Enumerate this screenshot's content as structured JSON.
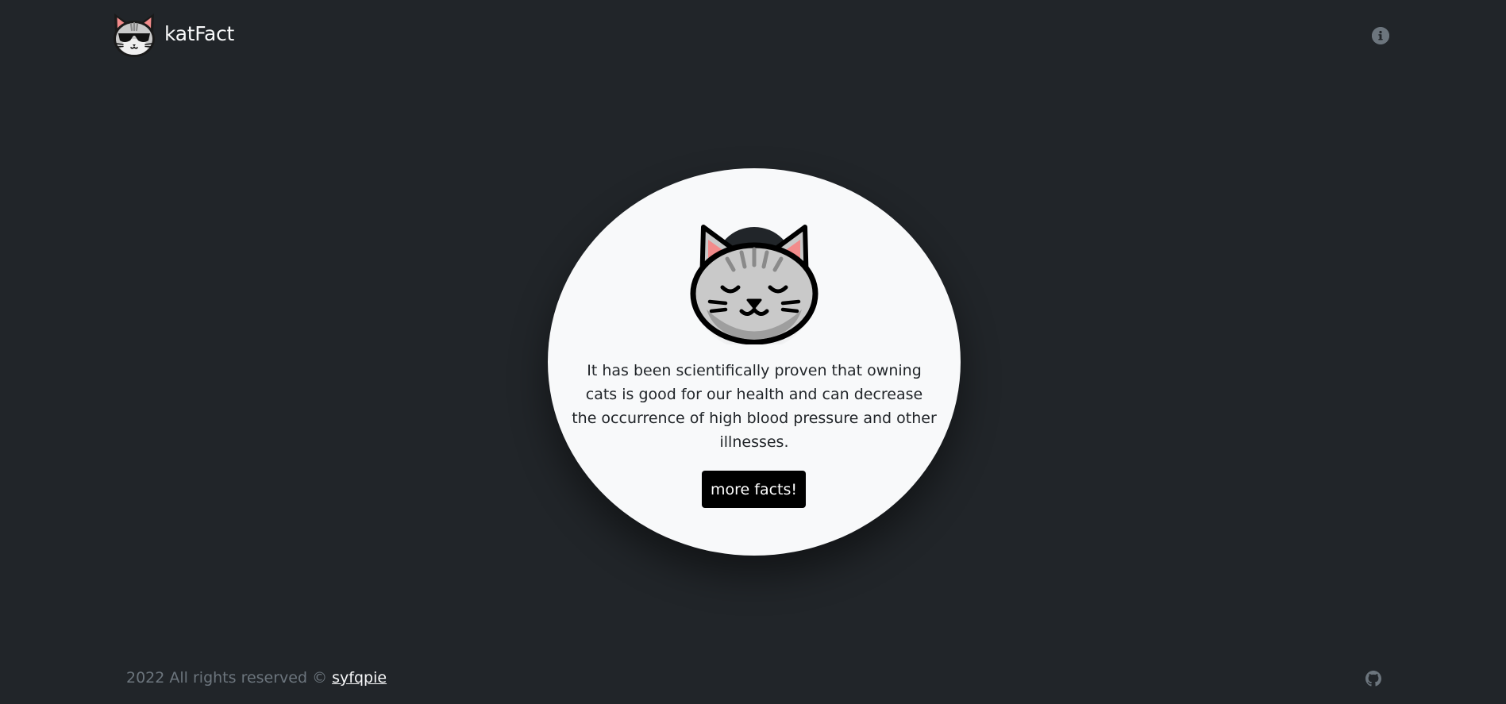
{
  "navbar": {
    "brand": "katFact",
    "logo_icon": "cool-cat-sunglasses-icon",
    "info_icon": "info-icon"
  },
  "card": {
    "image_icon": "sleeping-tabby-cat-icon",
    "fact": "It has been scientifically proven that owning cats is good for our health and can decrease the occurrence of high blood pressure and other illnesses.",
    "button_label": "more facts!"
  },
  "footer": {
    "copyright": "2022 All rights reserved © ",
    "author": "syfqpie",
    "github_icon": "github-icon"
  },
  "colors": {
    "background": "#212529",
    "card": "#f8f9fa",
    "button": "#000000",
    "muted": "#6c757d"
  }
}
